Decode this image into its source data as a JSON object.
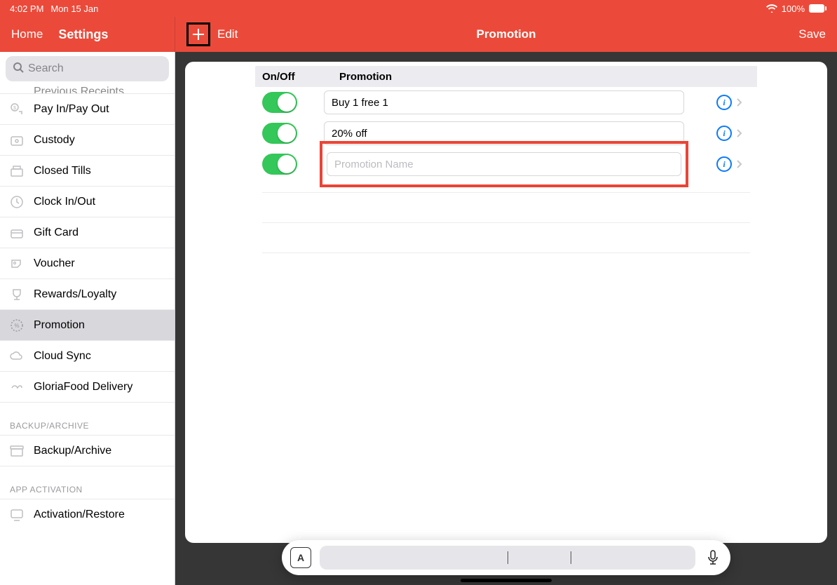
{
  "status": {
    "time": "4:02 PM",
    "date": "Mon 15 Jan",
    "battery": "100%"
  },
  "nav": {
    "home": "Home",
    "settings": "Settings",
    "edit": "Edit",
    "title": "Promotion",
    "save": "Save"
  },
  "search": {
    "placeholder": "Search"
  },
  "sidebar": {
    "cutoff_label": "Previous Receipts",
    "items": [
      {
        "label": "Pay In/Pay Out",
        "icon": "payinout"
      },
      {
        "label": "Custody",
        "icon": "custody"
      },
      {
        "label": "Closed Tills",
        "icon": "closedtills"
      },
      {
        "label": "Clock In/Out",
        "icon": "clock"
      },
      {
        "label": "Gift Card",
        "icon": "giftcard"
      },
      {
        "label": "Voucher",
        "icon": "voucher"
      },
      {
        "label": "Rewards/Loyalty",
        "icon": "rewards"
      },
      {
        "label": "Promotion",
        "icon": "promotion",
        "selected": true
      },
      {
        "label": "Cloud Sync",
        "icon": "cloud"
      },
      {
        "label": "GloriaFood Delivery",
        "icon": "delivery"
      }
    ],
    "section_backup": "BACKUP/ARCHIVE",
    "item_backup": "Backup/Archive",
    "section_activation": "APP ACTIVATION",
    "item_activation": "Activation/Restore"
  },
  "table": {
    "header_onoff": "On/Off",
    "header_promo": "Promotion",
    "rows": [
      {
        "on": true,
        "name": "Buy 1 free 1"
      },
      {
        "on": true,
        "name": "20% off"
      },
      {
        "on": true,
        "name": "",
        "placeholder": "Promotion Name",
        "focused": true
      }
    ]
  }
}
